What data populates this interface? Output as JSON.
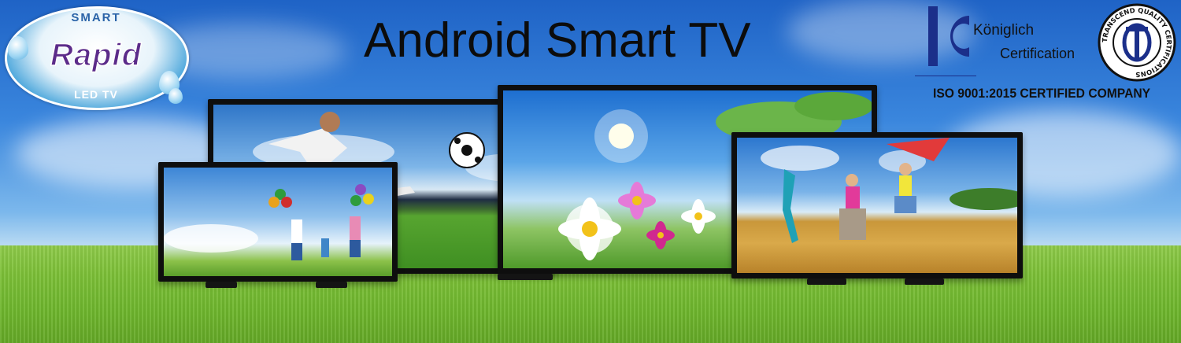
{
  "logo": {
    "top_text": "SMART",
    "brand": "Rapid",
    "bottom_text": "LED TV"
  },
  "title": "Android Smart TV",
  "certification": {
    "name": "Königlich",
    "subtitle": "Certification",
    "seal_text": "TRANSCEND QUALITY CERTIFICATIONS",
    "iso_text": "ISO 9001:2015 CERTIFIED COMPANY"
  },
  "colors": {
    "sky": "#2f78d6",
    "grass": "#74bb33",
    "title": "#0c0c0c",
    "brand": "#5b2b8a",
    "cert_blue": "#1b2f8a"
  },
  "icons": [
    "rapid-logo-icon",
    "konig-logo-icon",
    "certification-seal-icon"
  ]
}
